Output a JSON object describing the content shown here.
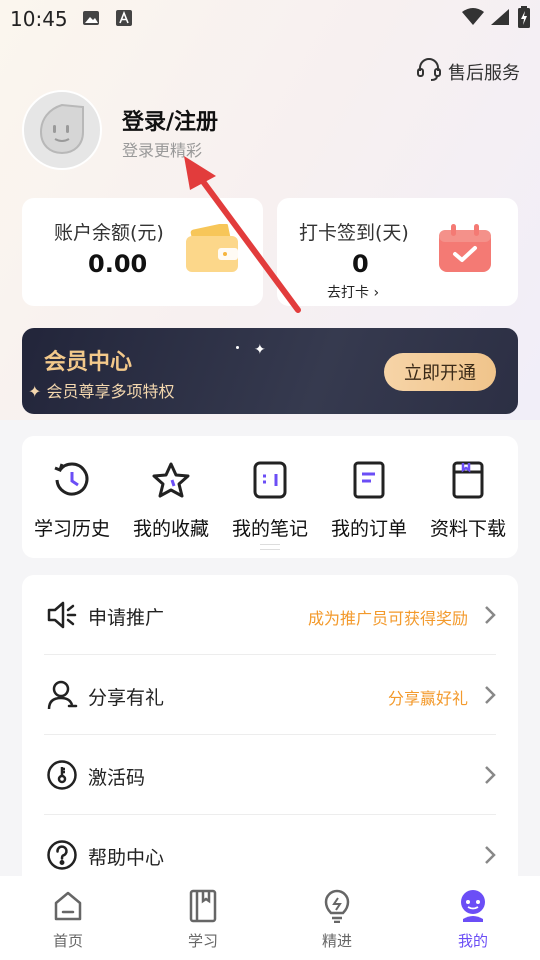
{
  "status_bar": {
    "time": "10:45"
  },
  "header": {
    "service_label": "售后服务"
  },
  "profile": {
    "title": "登录/注册",
    "subtitle": "登录更精彩"
  },
  "balance": {
    "label": "账户余额(元)",
    "value": "0.00"
  },
  "checkin": {
    "label": "打卡签到(天)",
    "value": "0",
    "action": "去打卡"
  },
  "vip": {
    "title": "会员中心",
    "subtitle": "会员尊享多项特权",
    "button": "立即开通"
  },
  "quick_items": [
    {
      "label": "学习历史",
      "icon": "history-icon"
    },
    {
      "label": "我的收藏",
      "icon": "star-icon"
    },
    {
      "label": "我的笔记",
      "icon": "notes-icon"
    },
    {
      "label": "我的订单",
      "icon": "order-icon"
    },
    {
      "label": "资料下载",
      "icon": "download-icon"
    }
  ],
  "menu": [
    {
      "label": "申请推广",
      "hint": "成为推广员可获得奖励",
      "icon": "speaker-icon"
    },
    {
      "label": "分享有礼",
      "hint": "分享赢好礼",
      "icon": "user-icon"
    },
    {
      "label": "激活码",
      "hint": "",
      "icon": "key-icon"
    },
    {
      "label": "帮助中心",
      "hint": "",
      "icon": "help-icon"
    }
  ],
  "tabs": [
    {
      "label": "首页",
      "icon": "home-icon"
    },
    {
      "label": "学习",
      "icon": "book-icon"
    },
    {
      "label": "精进",
      "icon": "bulb-icon"
    },
    {
      "label": "我的",
      "icon": "profile-icon",
      "active": true
    }
  ],
  "colors": {
    "accent": "#6b4ef6",
    "hint": "#f39a2c",
    "vip_bg": "#22253a",
    "vip_gold": "#f3c98b",
    "annotation_arrow": "#e23c3c"
  }
}
